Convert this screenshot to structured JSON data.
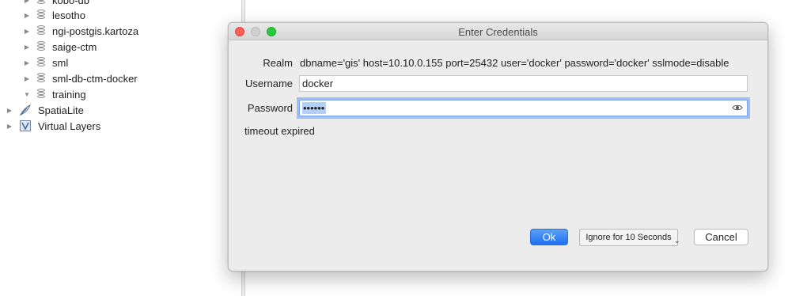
{
  "tree": {
    "items": [
      {
        "label": "kobo-db",
        "expanded": false
      },
      {
        "label": "lesotho",
        "expanded": false
      },
      {
        "label": "ngi-postgis.kartoza",
        "expanded": false
      },
      {
        "label": "saige-ctm",
        "expanded": false
      },
      {
        "label": "sml",
        "expanded": false
      },
      {
        "label": "sml-db-ctm-docker",
        "expanded": false
      },
      {
        "label": "training",
        "expanded": true
      }
    ],
    "providers": [
      {
        "label": "SpatiaLite",
        "icon": "feather-icon"
      },
      {
        "label": "Virtual Layers",
        "icon": "virtual-layers-icon"
      }
    ]
  },
  "dialog": {
    "title": "Enter Credentials",
    "realm_label": "Realm",
    "realm_value": "dbname='gis' host=10.10.0.155 port=25432 user='docker' password='docker' sslmode=disable",
    "username_label": "Username",
    "username_value": "docker",
    "password_label": "Password",
    "password_masked": "••••••",
    "status": "timeout expired",
    "ok_label": "Ok",
    "ignore_label": "Ignore for 10 Seconds",
    "cancel_label": "Cancel"
  },
  "colors": {
    "ok_button": "#1e6ff0",
    "focus_ring": "#9ebff3",
    "selection": "#b3d1f7"
  }
}
